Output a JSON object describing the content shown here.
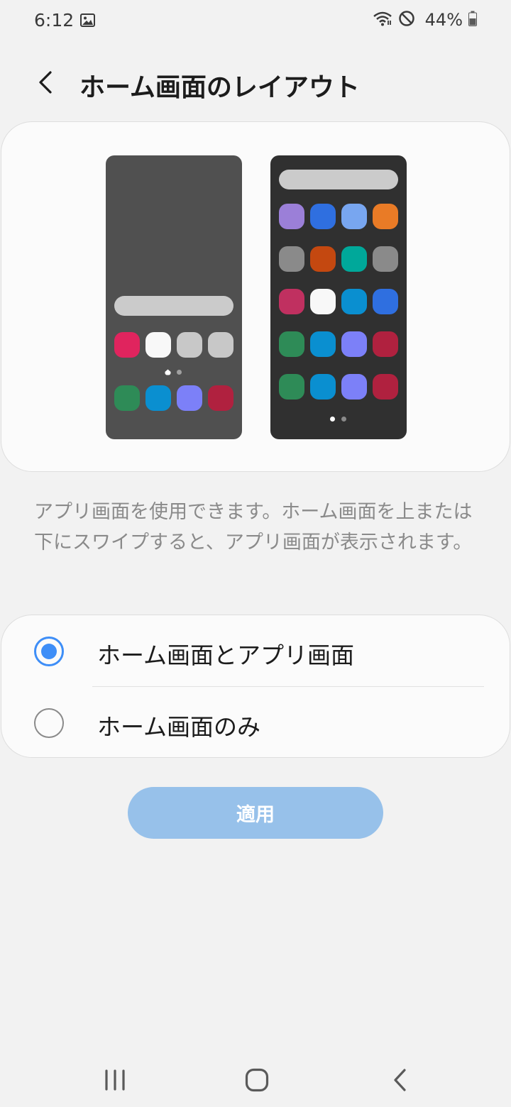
{
  "status_bar": {
    "time": "6:12",
    "battery": "44%",
    "icons": [
      "image-icon",
      "wifi-icon",
      "do-not-disturb-icon",
      "battery-icon"
    ]
  },
  "header": {
    "title": "ホーム画面のレイアウト",
    "back_icon": "chevron-left-icon"
  },
  "preview": {
    "light_phone": {
      "background": "#505050",
      "row1": [
        "#e0245e",
        "#f8f8f8",
        "#c8c8c8",
        "#c8c8c8"
      ],
      "dock": [
        "#2e8b57",
        "#0a8fd0",
        "#7c80f8",
        "#b0213f"
      ]
    },
    "dark_phone": {
      "background": "#303030",
      "grid": [
        [
          "#9b7fd8",
          "#2f6fe0",
          "#78a6f0",
          "#e97b26"
        ],
        [
          "#8a8a8a",
          "#c44810",
          "#00a89a",
          "#8a8a8a"
        ],
        [
          "#c03060",
          "#f8f8f8",
          "#0a8fd0",
          "#2f6fe0"
        ],
        [
          "#2e8b57",
          "#0a8fd0",
          "#7c80f8",
          "#b0213f"
        ],
        [
          "#2e8b57",
          "#0a8fd0",
          "#7c80f8",
          "#b0213f"
        ]
      ]
    }
  },
  "description": "アプリ画面を使用できます。ホーム画面を上または下にスワイプすると、アプリ画面が表示されます。",
  "options": [
    {
      "label": "ホーム画面とアプリ画面",
      "selected": true
    },
    {
      "label": "ホーム画面のみ",
      "selected": false
    }
  ],
  "apply_button": {
    "label": "適用"
  },
  "colors": {
    "accent": "#3e8ef7",
    "apply_button": "#97c1ea",
    "background": "#f2f2f2"
  },
  "nav_bar": {
    "icons": [
      "recents-icon",
      "home-icon",
      "back-icon"
    ]
  }
}
